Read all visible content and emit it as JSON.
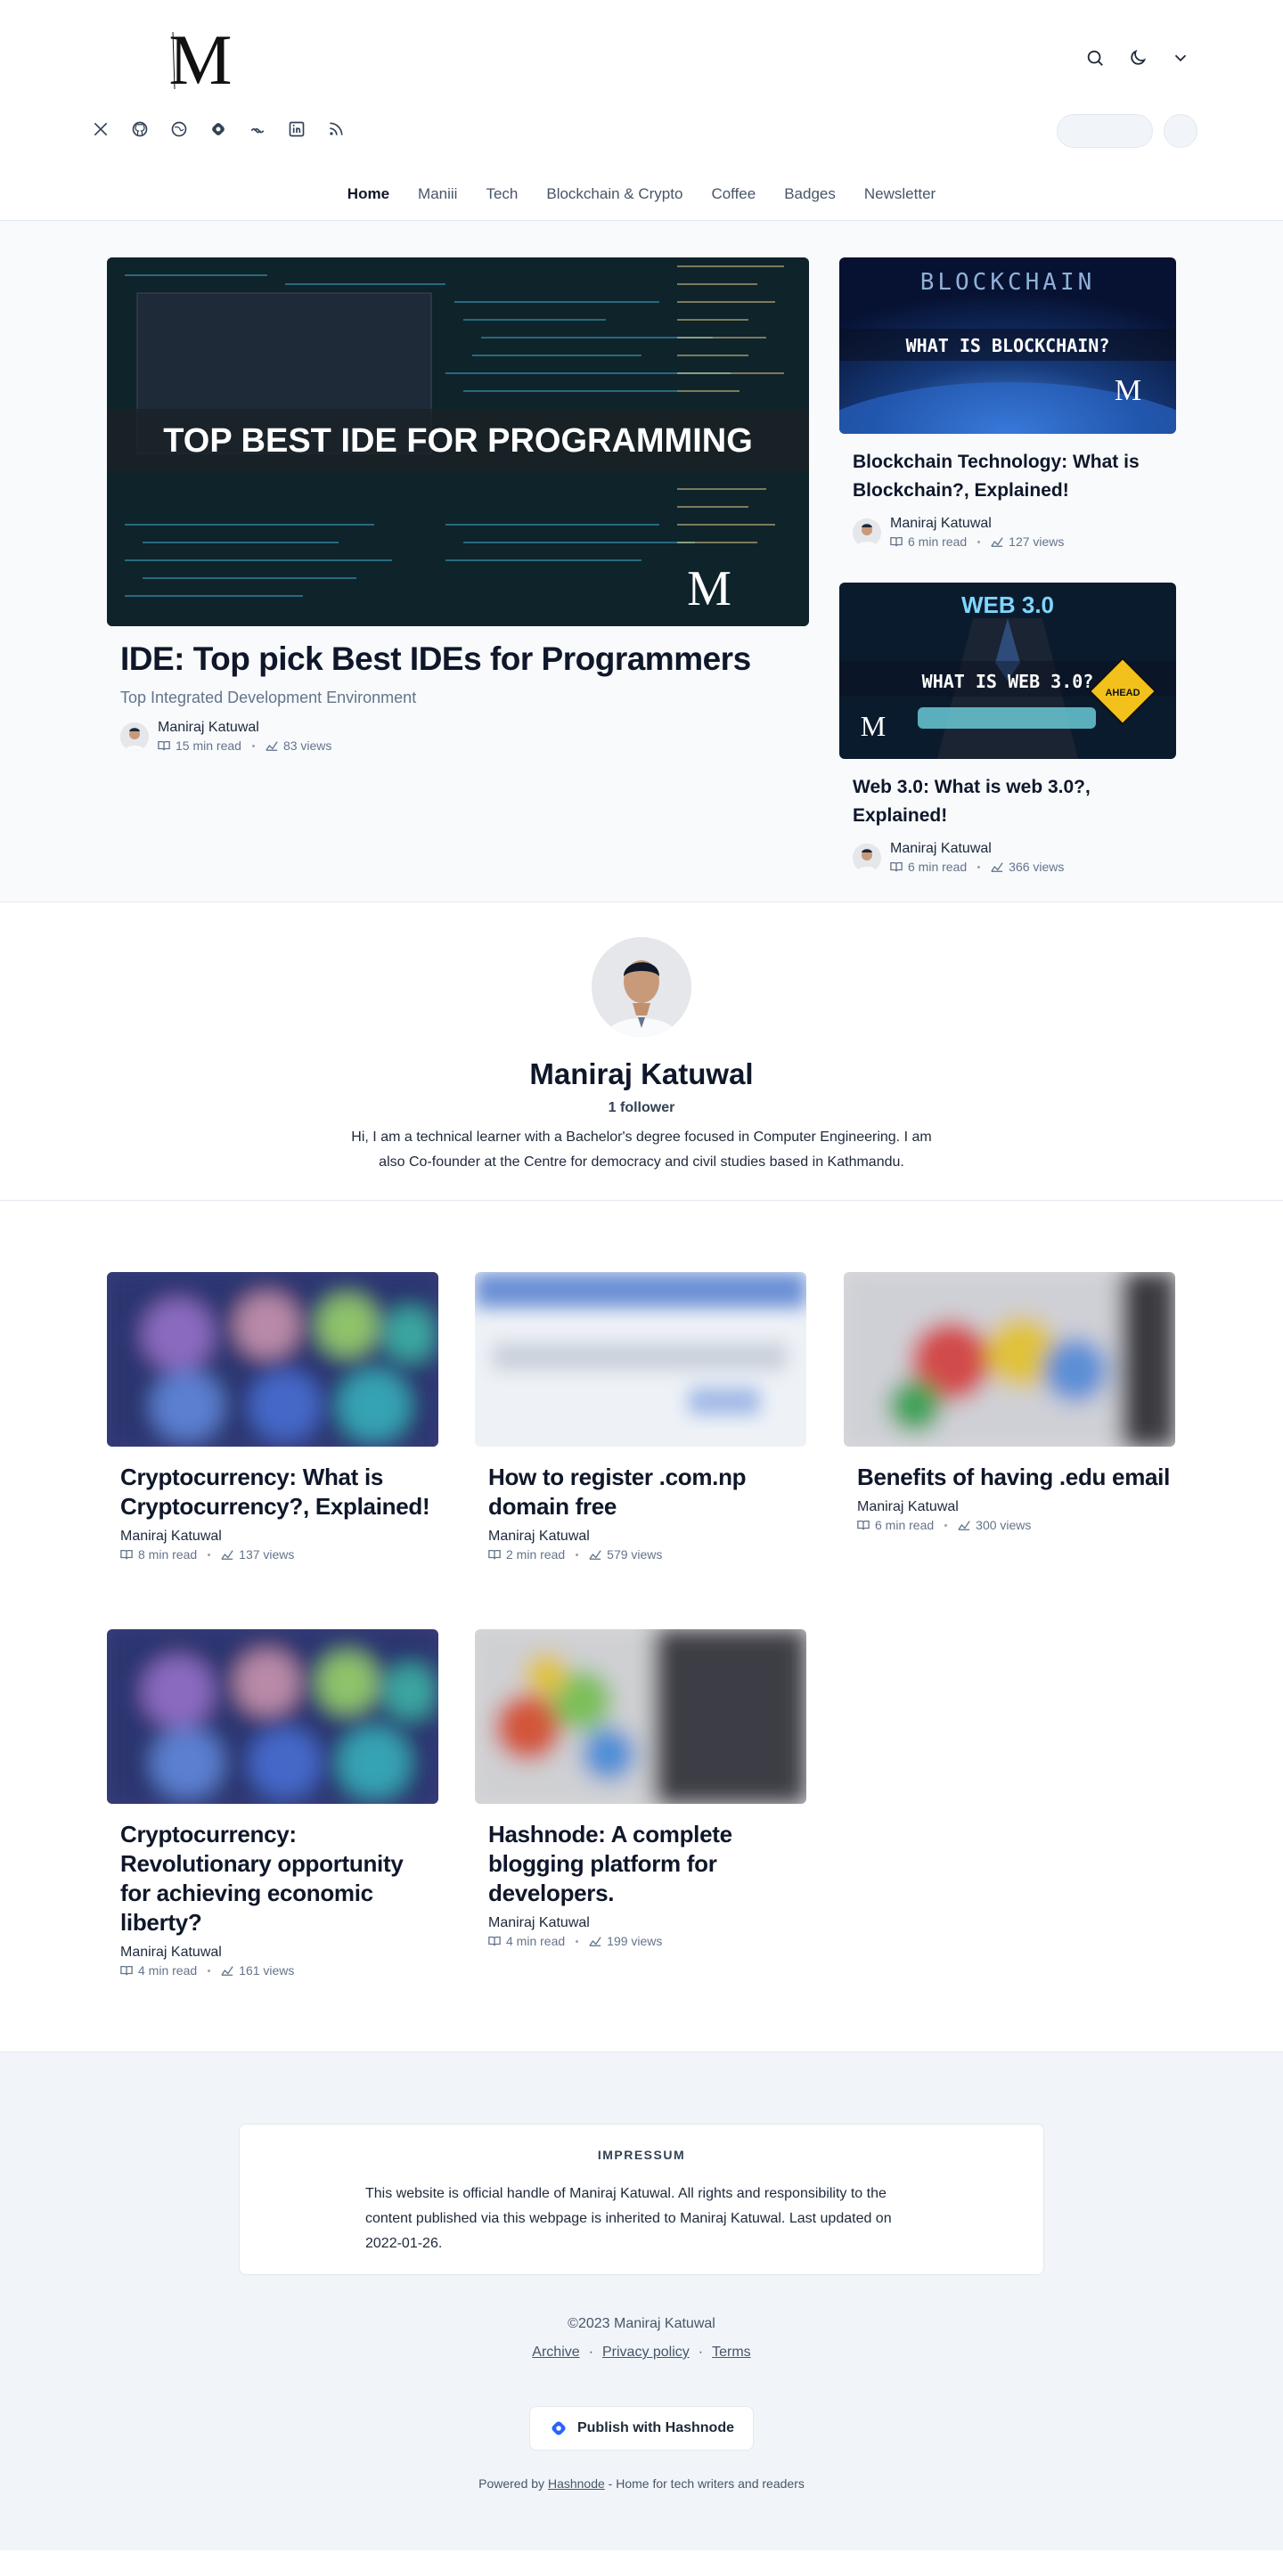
{
  "header": {
    "logo_letter": "M",
    "nav": [
      "Home",
      "Maniii",
      "Tech",
      "Blockchain & Crypto",
      "Coffee",
      "Badges",
      "Newsletter"
    ],
    "active_nav": "Home"
  },
  "featured": {
    "main": {
      "image_caption": "TOP BEST IDE FOR PROGRAMMING",
      "title": "IDE: Top pick Best IDEs for Programmers",
      "subtitle": "Top Integrated Development Environment",
      "author": "Maniraj Katuwal",
      "read_time": "15 min read",
      "views": "83 views"
    },
    "side": [
      {
        "image_top": "BLOCKCHAIN",
        "image_caption": "WHAT IS BLOCKCHAIN?",
        "title": "Blockchain Technology: What is Blockchain?, Explained!",
        "author": "Maniraj Katuwal",
        "read_time": "6 min read",
        "views": "127 views"
      },
      {
        "image_top": "WEB 3.0",
        "image_caption": "WHAT IS WEB 3.0?",
        "image_sign": "AHEAD",
        "title": "Web 3.0: What is web 3.0?, Explained!",
        "author": "Maniraj Katuwal",
        "read_time": "6 min read",
        "views": "366 views"
      }
    ]
  },
  "author_section": {
    "name": "Maniraj Katuwal",
    "followers": "1 follower",
    "bio": "Hi, I am a technical learner with a Bachelor's degree focused in Computer Engineering. I am also Co-founder at the Centre for democracy and civil studies based in Kathmandu."
  },
  "posts": [
    {
      "title": "Cryptocurrency: What is Cryptocurrency?, Explained!",
      "author": "Maniraj Katuwal",
      "read_time": "8 min read",
      "views": "137 views"
    },
    {
      "title": "How to register .com.np domain free",
      "author": "Maniraj Katuwal",
      "read_time": "2 min read",
      "views": "579 views"
    },
    {
      "title": "Benefits of having .edu email",
      "author": "Maniraj Katuwal",
      "read_time": "6 min read",
      "views": "300 views"
    },
    {
      "title": "Cryptocurrency: Revolutionary opportunity for achieving economic liberty?",
      "author": "Maniraj Katuwal",
      "read_time": "4 min read",
      "views": "161 views"
    },
    {
      "title": "Hashnode: A complete blogging platform for developers.",
      "author": "Maniraj Katuwal",
      "read_time": "4 min read",
      "views": "199 views"
    }
  ],
  "footer": {
    "impressum_title": "IMPRESSUM",
    "impressum_text": "This website is official handle of Maniraj Katuwal. All rights and responsibility to the content published via this webpage is inherited to Maniraj Katuwal. Last updated on 2022-01-26.",
    "copyright": "©2023 Maniraj Katuwal",
    "links": [
      "Archive",
      "Privacy policy",
      "Terms"
    ],
    "publish_label": "Publish with Hashnode",
    "powered_prefix": "Powered by",
    "powered_link": "Hashnode",
    "powered_suffix": "- Home for tech writers and readers"
  },
  "icons": {
    "header_actions": [
      "search-icon",
      "moon-icon",
      "chevron-down-icon"
    ],
    "socials": [
      "x-icon",
      "github-icon",
      "globe-icon",
      "hashnode-icon",
      "link-icon",
      "linkedin-icon",
      "rss-icon"
    ]
  },
  "colors": {
    "text": "#0f172a",
    "muted": "#64748b",
    "featured_bg": "#f8fafc",
    "footer_bg": "#f1f5f9",
    "hashnode_blue": "#2962ff"
  }
}
